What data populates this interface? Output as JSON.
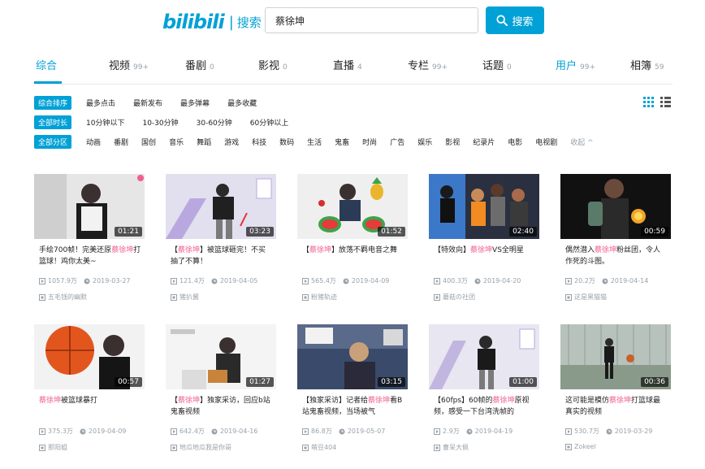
{
  "header": {
    "logo": "bilibili",
    "logo_sub": "搜索",
    "search_value": "蔡徐坤",
    "search_button": "搜索"
  },
  "tabs": [
    {
      "label": "综合",
      "count": ""
    },
    {
      "label": "视频",
      "count": "99+"
    },
    {
      "label": "番剧",
      "count": "0"
    },
    {
      "label": "影视",
      "count": "0"
    },
    {
      "label": "直播",
      "count": "4"
    },
    {
      "label": "专栏",
      "count": "99+"
    },
    {
      "label": "话题",
      "count": "0"
    },
    {
      "label": "用户",
      "count": "99+"
    },
    {
      "label": "相簿",
      "count": "59"
    }
  ],
  "filters": {
    "sort": {
      "chip": "综合排序",
      "options": [
        "最多点击",
        "最新发布",
        "最多弹幕",
        "最多收藏"
      ]
    },
    "duration": {
      "chip": "全部时长",
      "options": [
        "10分钟以下",
        "10-30分钟",
        "30-60分钟",
        "60分钟以上"
      ]
    },
    "zone": {
      "chip": "全部分区",
      "options": [
        "动画",
        "番剧",
        "国创",
        "音乐",
        "舞蹈",
        "游戏",
        "科技",
        "数码",
        "生活",
        "鬼畜",
        "时尚",
        "广告",
        "娱乐",
        "影视",
        "纪录片",
        "电影",
        "电视剧",
        "收起 ^"
      ]
    }
  },
  "videos": [
    {
      "title_pre": "手绘700帧！完美还原",
      "title_hl": "蔡徐坤",
      "title_post": "打篮球！鸡你太美~",
      "duration": "01:21",
      "views": "1057.9万",
      "date": "2019-03-27",
      "uploader": "五毛钱的幽默"
    },
    {
      "title_pre": "【",
      "title_hl": "蔡徐坤",
      "title_post": "】被篮球砸完！不买抽了不算！",
      "duration": "03:23",
      "views": "121.4万",
      "date": "2019-04-05",
      "uploader": "猪扒酱"
    },
    {
      "title_pre": "【",
      "title_hl": "蔡徐坤",
      "title_post": "】放荡不羁电音之舞",
      "duration": "01:52",
      "views": "565.4万",
      "date": "2019-04-09",
      "uploader": "粉猪轨迹"
    },
    {
      "title_pre": "【特效向】",
      "title_hl": "蔡徐坤",
      "title_post": "VS全明星",
      "duration": "02:40",
      "views": "400.3万",
      "date": "2019-04-20",
      "uploader": "蘑菇の社团"
    },
    {
      "title_pre": "偶然潜入",
      "title_hl": "蔡徐坤",
      "title_post": "粉丝团，令人作死的斗图。",
      "duration": "00:59",
      "views": "20.2万",
      "date": "2019-04-14",
      "uploader": "这是黑猫猫"
    },
    {
      "title_pre": "",
      "title_hl": "蔡徐坤",
      "title_post": "被篮球暴打",
      "duration": "00:57",
      "views": "375.3万",
      "date": "2019-04-09",
      "uploader": "那阳姐"
    },
    {
      "title_pre": "【",
      "title_hl": "蔡徐坤",
      "title_post": "】独家采访，回应b站鬼畜视频",
      "duration": "01:27",
      "views": "642.4万",
      "date": "2019-04-16",
      "uploader": "地瓜地瓜我是你哥"
    },
    {
      "title_pre": "【独家采访】记者给",
      "title_hl": "蔡徐坤",
      "title_post": "看B站鬼畜视频，当场被气",
      "duration": "03:15",
      "views": "86.8万",
      "date": "2019-05-07",
      "uploader": "萌豆404"
    },
    {
      "title_pre": "【60fps】60帧的",
      "title_hl": "蔡徐坤",
      "title_post": "原视频，感受一下台湾洗帧的",
      "duration": "01:00",
      "views": "2.9万",
      "date": "2019-04-19",
      "uploader": "曹呆大佩"
    },
    {
      "title_pre": "这可能是模仿",
      "title_hl": "蔡徐坤",
      "title_post": "打篮球最真实的视频",
      "duration": "00:36",
      "views": "530.7万",
      "date": "2019-03-29",
      "uploader": "Zokeel"
    }
  ],
  "colors": {
    "accent": "#00a1d6",
    "highlight": "#f25d8e",
    "meta": "#99a2aa"
  }
}
